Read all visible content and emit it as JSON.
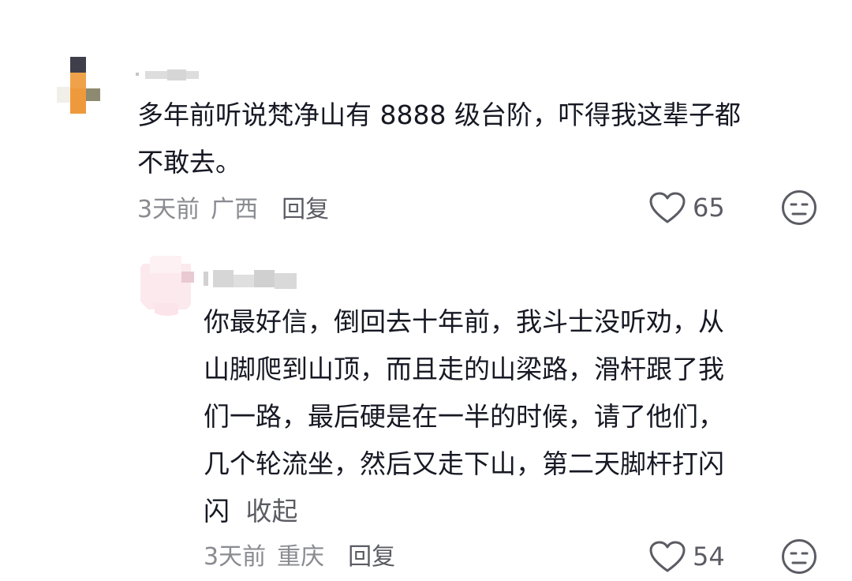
{
  "comments": [
    {
      "text_lines": [
        "多年前听说梵净山有 8888 级台阶，吓得我这辈子都",
        "不敢去。"
      ],
      "time": "3天前",
      "region": "广西",
      "reply_label": "回复",
      "like_count": "65"
    }
  ],
  "replies": [
    {
      "text_lines": [
        "你最好信，倒回去十年前，我斗士没听劝，从",
        "山脚爬到山顶，而且走的山梁路，滑杆跟了我",
        "们一路，最后硬是在一半的时候，请了他们，",
        "几个轮流坐，然后又走下山，第二天脚杆打闪",
        "闪"
      ],
      "expand_label": "收起",
      "time": "3天前",
      "region": "重庆",
      "reply_label": "回复",
      "like_count": "54"
    }
  ],
  "icons": {
    "like": "heart-outline-icon",
    "dislike": "meh-face-icon"
  },
  "colors": {
    "text": "#161823",
    "meta": "#8a8b91",
    "action": "#5b5c63"
  }
}
